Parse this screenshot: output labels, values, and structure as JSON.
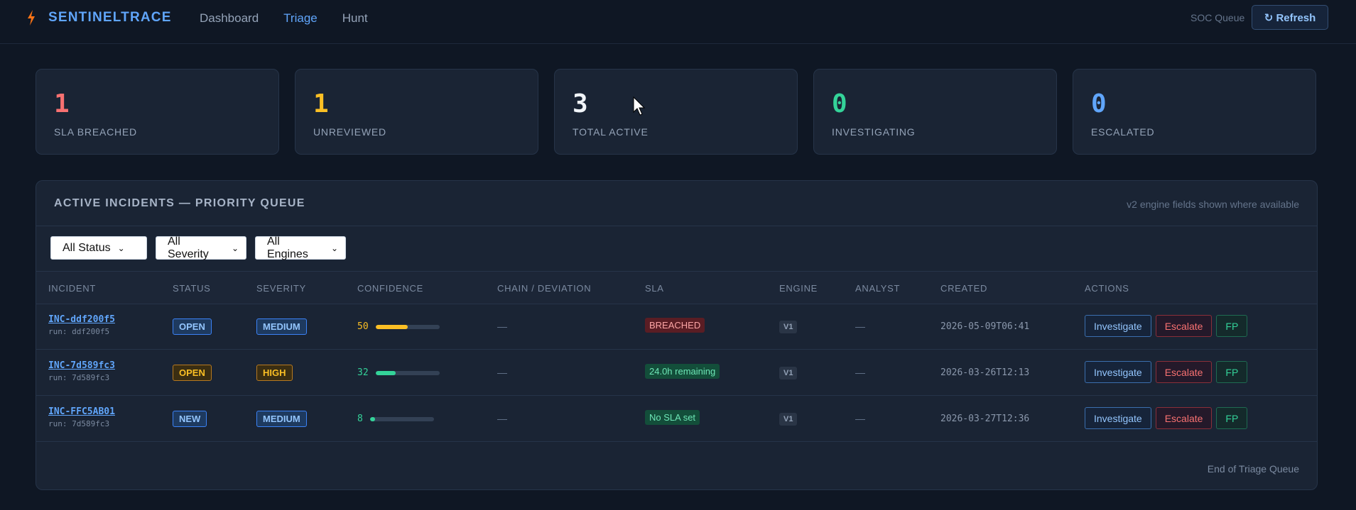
{
  "brand": {
    "name": "SENTINELTRACE"
  },
  "nav": [
    {
      "label": "Dashboard",
      "active": false
    },
    {
      "label": "Triage",
      "active": true
    },
    {
      "label": "Hunt",
      "active": false
    }
  ],
  "header": {
    "queue_label": "SOC Queue",
    "refresh_label": "↻ Refresh"
  },
  "stats": [
    {
      "value": "1",
      "label": "SLA BREACHED",
      "color": "#f87171"
    },
    {
      "value": "1",
      "label": "UNREVIEWED",
      "color": "#fbbf24"
    },
    {
      "value": "3",
      "label": "TOTAL ACTIVE",
      "color": "#f1f5f9"
    },
    {
      "value": "0",
      "label": "INVESTIGATING",
      "color": "#34d399"
    },
    {
      "value": "0",
      "label": "ESCALATED",
      "color": "#60a5fa"
    }
  ],
  "panel": {
    "title": "ACTIVE INCIDENTS — PRIORITY QUEUE",
    "note": "v2 engine fields shown where available",
    "footer": "End of Triage Queue"
  },
  "filters": [
    {
      "selected": "All Status"
    },
    {
      "selected": "All Severity"
    },
    {
      "selected": "All Engines"
    }
  ],
  "columns": [
    "INCIDENT",
    "STATUS",
    "SEVERITY",
    "CONFIDENCE",
    "CHAIN / DEVIATION",
    "SLA",
    "ENGINE",
    "ANALYST",
    "CREATED",
    "ACTIONS"
  ],
  "actions": {
    "investigate": "Investigate",
    "escalate": "Escalate",
    "fp": "FP"
  },
  "incidents": [
    {
      "id": "INC-ddf200f5",
      "run": "run: ddf200f5",
      "status": "OPEN",
      "severity": "MEDIUM",
      "confidence": 50,
      "chain": "—",
      "sla": "BREACHED",
      "engine": "V1",
      "analyst": "—",
      "created": "2026-05-09T06:41"
    },
    {
      "id": "INC-7d589fc3",
      "run": "run: 7d589fc3",
      "status": "OPEN",
      "severity": "HIGH",
      "confidence": 32,
      "chain": "—",
      "sla": "24.0h remaining",
      "engine": "V1",
      "analyst": "—",
      "created": "2026-03-26T12:13"
    },
    {
      "id": "INC-FFC5AB01",
      "run": "run: 7d589fc3",
      "status": "NEW",
      "severity": "MEDIUM",
      "confidence": 8,
      "chain": "—",
      "sla": "No SLA set",
      "engine": "V1",
      "analyst": "—",
      "created": "2026-03-27T12:36"
    }
  ]
}
